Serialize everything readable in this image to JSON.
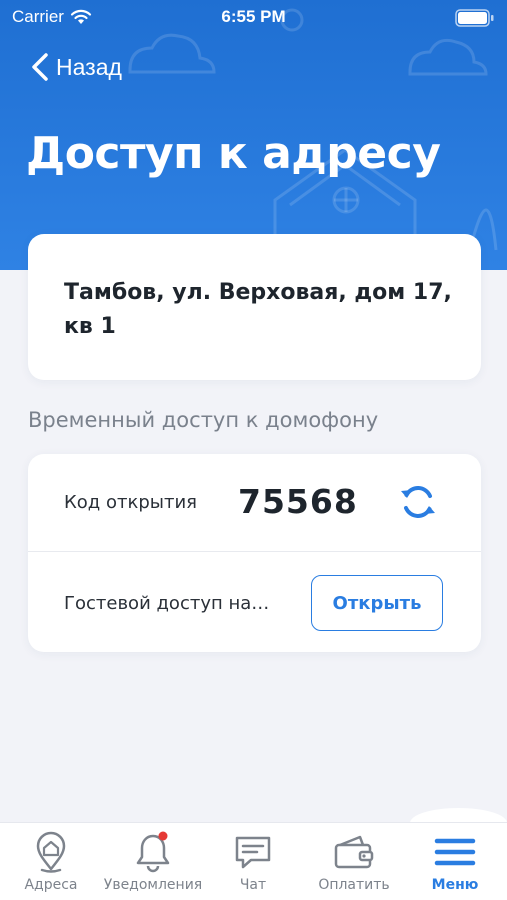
{
  "status_bar": {
    "carrier": "Carrier",
    "time": "6:55 PM"
  },
  "nav": {
    "back_label": "Назад"
  },
  "page": {
    "title": "Доступ к адресу"
  },
  "address": {
    "text": "Тамбов, ул. Верховая, дом 17, кв 1"
  },
  "intercom": {
    "section_title": "Временный доступ к домофону",
    "code_label": "Код открытия",
    "code_value": "75568",
    "guest_label": "Гостевой доступ на…",
    "open_button": "Открыть"
  },
  "tabbar": {
    "items": [
      {
        "label": "Адреса",
        "icon": "location-pin-icon"
      },
      {
        "label": "Уведомления",
        "icon": "bell-icon",
        "badge": true
      },
      {
        "label": "Чат",
        "icon": "chat-icon"
      },
      {
        "label": "Оплатить",
        "icon": "wallet-icon"
      },
      {
        "label": "Меню",
        "icon": "menu-icon",
        "active": true
      }
    ]
  },
  "colors": {
    "primary": "#2a7de1",
    "header_top": "#1f6fd2",
    "badge": "#e53935"
  }
}
